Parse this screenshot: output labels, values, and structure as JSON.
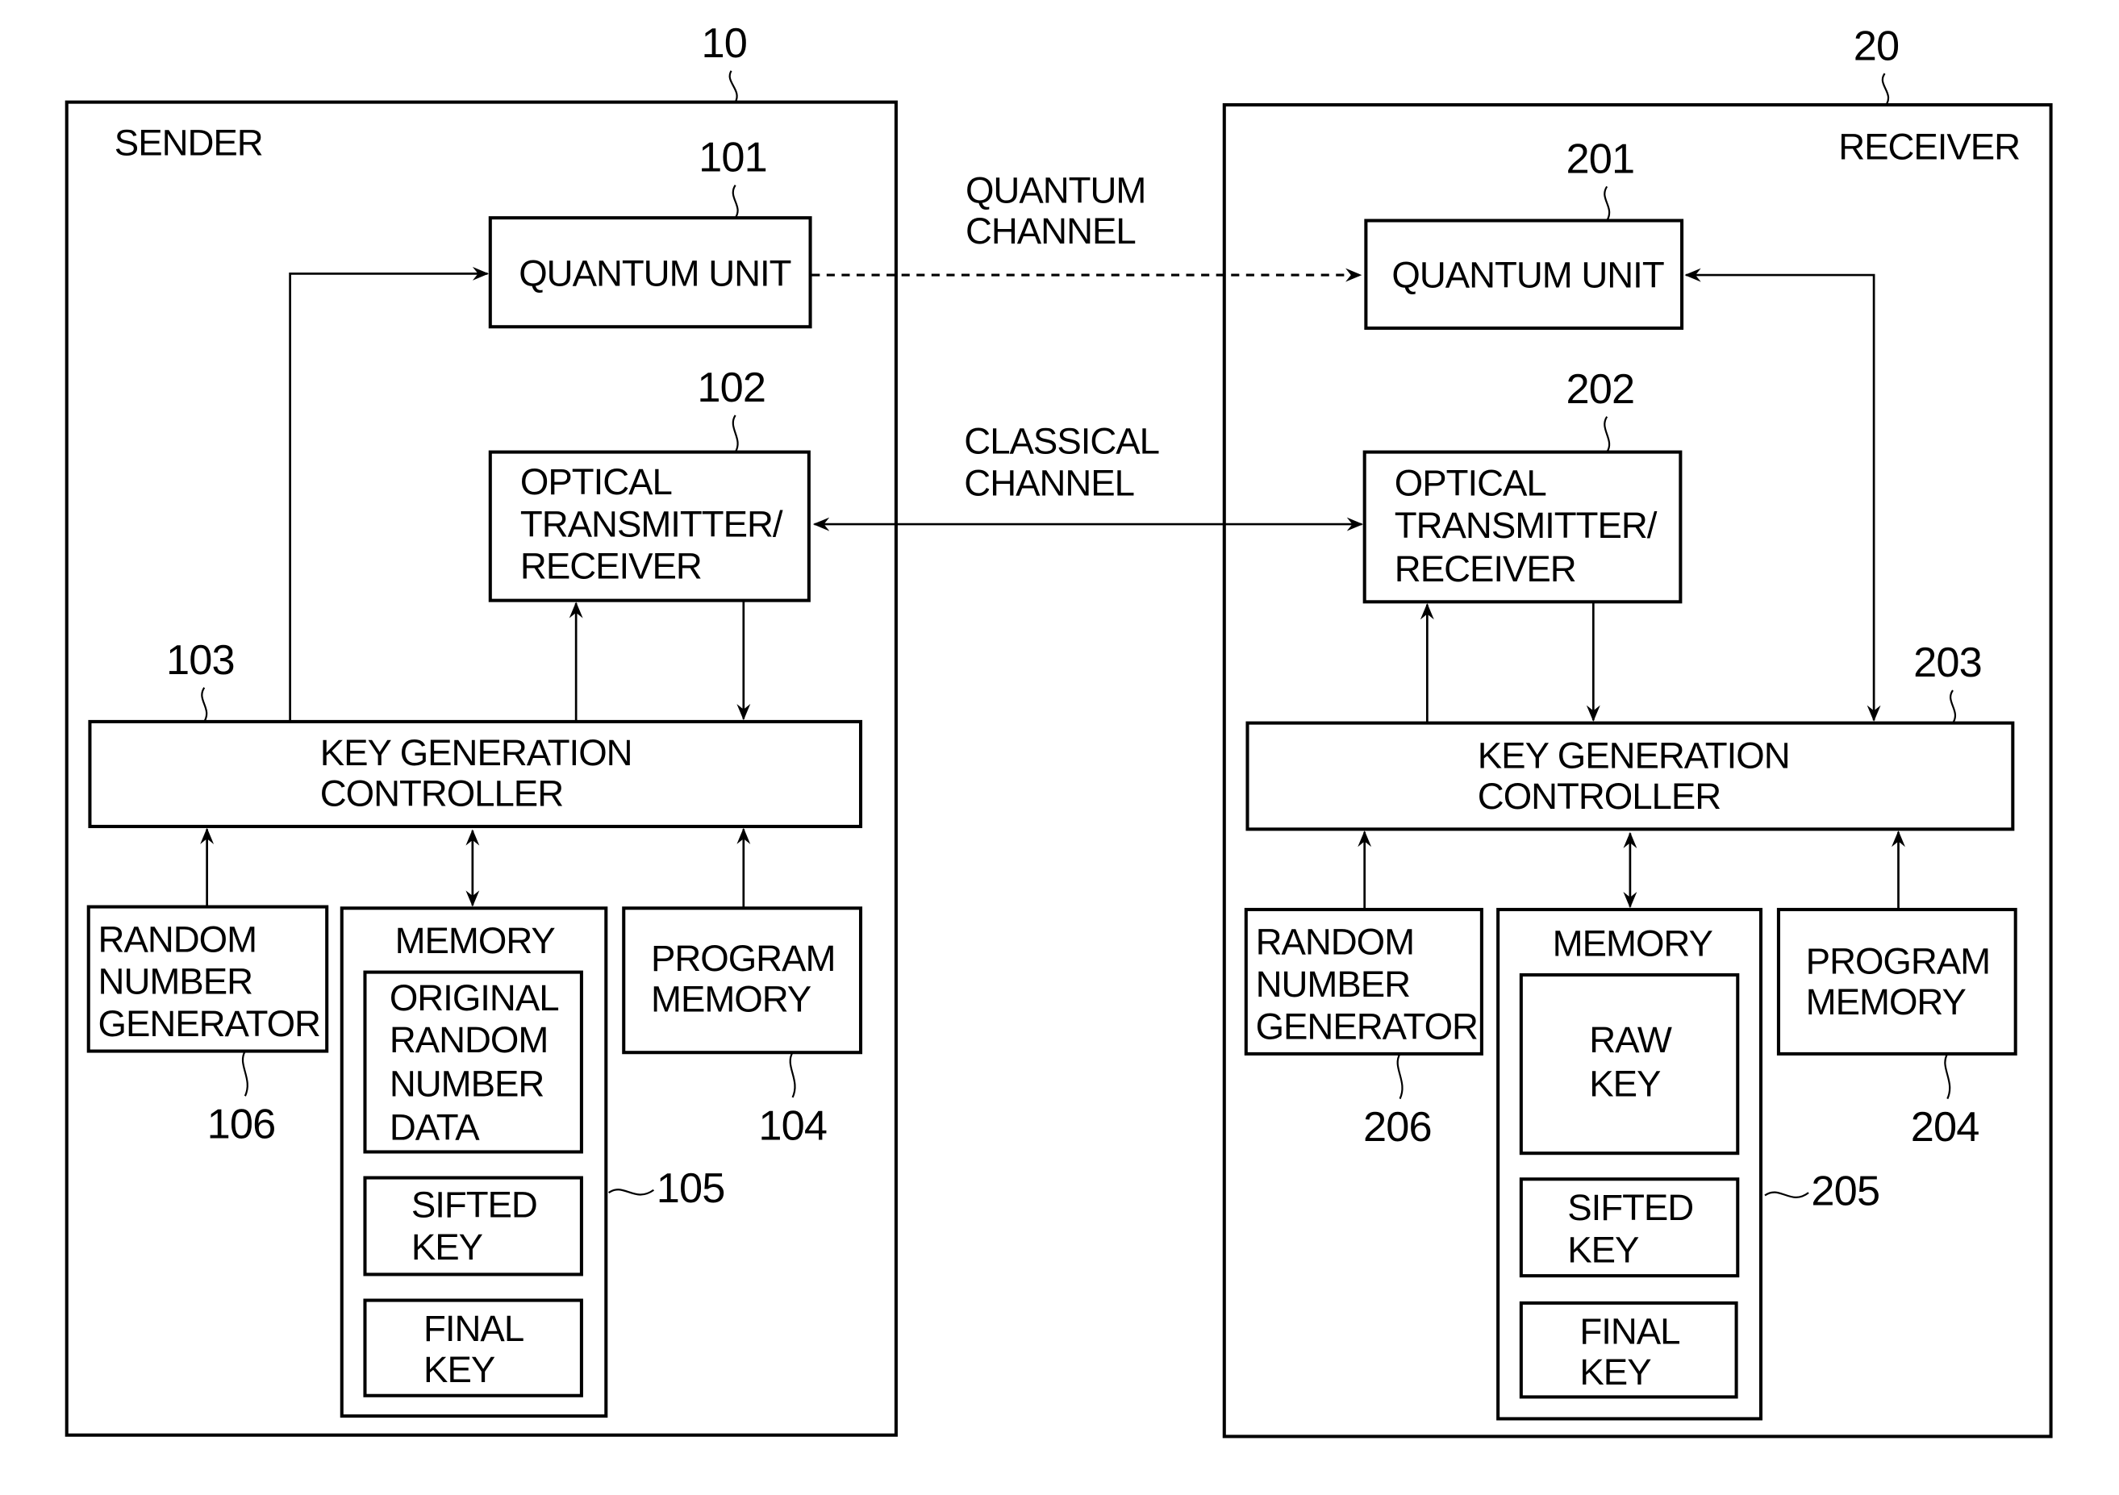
{
  "diagram": {
    "type": "block-diagram",
    "colors": {
      "ink": "#000000",
      "background": "#ffffff"
    },
    "channels": {
      "quantum": {
        "label_line1": "QUANTUM",
        "label_line2": "CHANNEL",
        "style": "dashed",
        "direction": "sender-to-receiver"
      },
      "classical": {
        "label_line1": "CLASSICAL",
        "label_line2": "CHANNEL",
        "style": "solid",
        "direction": "bidirectional"
      }
    },
    "sender": {
      "ref": "10",
      "title": "SENDER",
      "quantum_unit": {
        "ref": "101",
        "label": "QUANTUM UNIT"
      },
      "optical": {
        "ref": "102",
        "line1": "OPTICAL",
        "line2": "TRANSMITTER/",
        "line3": "RECEIVER"
      },
      "controller": {
        "ref": "103",
        "line1": "KEY GENERATION",
        "line2": "CONTROLLER"
      },
      "program_memory": {
        "ref": "104",
        "line1": "PROGRAM",
        "line2": "MEMORY"
      },
      "memory": {
        "ref": "105",
        "title": "MEMORY",
        "original": {
          "line1": "ORIGINAL",
          "line2": "RANDOM",
          "line3": "NUMBER",
          "line4": "DATA"
        },
        "sifted": {
          "line1": "SIFTED",
          "line2": "KEY"
        },
        "final": {
          "line1": "FINAL",
          "line2": "KEY"
        }
      },
      "rng": {
        "ref": "106",
        "line1": "RANDOM",
        "line2": "NUMBER",
        "line3": "GENERATOR"
      }
    },
    "receiver": {
      "ref": "20",
      "title": "RECEIVER",
      "quantum_unit": {
        "ref": "201",
        "label": "QUANTUM UNIT"
      },
      "optical": {
        "ref": "202",
        "line1": "OPTICAL",
        "line2": "TRANSMITTER/",
        "line3": "RECEIVER"
      },
      "controller": {
        "ref": "203",
        "line1": "KEY GENERATION",
        "line2": "CONTROLLER"
      },
      "program_memory": {
        "ref": "204",
        "line1": "PROGRAM",
        "line2": "MEMORY"
      },
      "memory": {
        "ref": "205",
        "title": "MEMORY",
        "raw": {
          "line1": "RAW",
          "line2": "KEY"
        },
        "sifted": {
          "line1": "SIFTED",
          "line2": "KEY"
        },
        "final": {
          "line1": "FINAL",
          "line2": "KEY"
        }
      },
      "rng": {
        "ref": "206",
        "line1": "RANDOM",
        "line2": "NUMBER",
        "line3": "GENERATOR"
      }
    }
  }
}
